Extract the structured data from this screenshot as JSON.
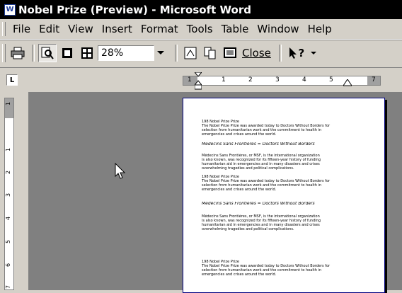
{
  "window": {
    "title": "Nobel Prize (Preview) - Microsoft Word",
    "app_icon": "W"
  },
  "menu": [
    "File",
    "Edit",
    "View",
    "Insert",
    "Format",
    "Tools",
    "Table",
    "Window",
    "Help"
  ],
  "toolbar": {
    "zoom_value": "28%",
    "close_label": "Close",
    "help_label": "?"
  },
  "ruler": {
    "tab_selector": "L",
    "h_labels": [
      "1",
      "1",
      "2",
      "3",
      "4",
      "5",
      "7"
    ],
    "v_labels": [
      "1",
      "1",
      "2",
      "3",
      "4",
      "5",
      "6",
      "7"
    ]
  },
  "document": {
    "lines": [
      "198 Nobel Prize Prize",
      "The Nobel Prize Prize was awarded today to Doctors Without Borders for",
      "selection from humanitarian work and the commitment to health in",
      "emergencies and crises around the world.",
      "Médecins Sans Frontières = Doctors Without Borders",
      "Médecins Sans Frontières, or MSF, is the international organization",
      "is also known, was recognized for its fifteen-year history of funding",
      "humanitarian aid in emergencies and in many disasters and crises",
      "overwhelming tragedies and political complications.",
      "198 Nobel Prize Prize",
      "The Nobel Prize Prize was awarded today to Doctors Without Borders for",
      "selection from humanitarian work and the commitment to health in",
      "emergencies and crises around the world.",
      "Médecins Sans Frontières = Doctors Without Borders",
      "Médecins Sans Frontières, or MSF, is the international organization",
      "is also known, was recognized for its fifteen-year history of funding",
      "humanitarian aid in emergencies and in many disasters and crises",
      "overwhelming tragedies and political complications.",
      "198 Nobel Prize Prize",
      "The Nobel Prize Prize was awarded today to Doctors Without Borders for",
      "selection from humanitarian work and the commitment to health in",
      "emergencies and crises around the world."
    ]
  },
  "colors": {
    "titlebar": "#000000",
    "chrome": "#d4d0c8",
    "workspace": "#808080"
  }
}
